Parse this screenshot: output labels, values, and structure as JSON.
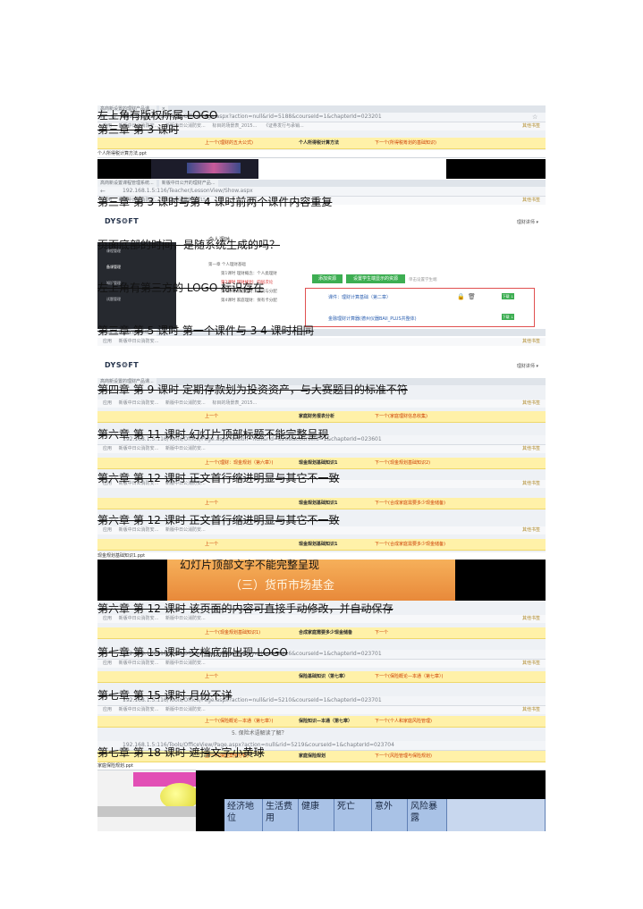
{
  "captions": [
    "左上角有版权所属 LOGO",
    "第三章 第 3 课时",
    "第三章 第 3 课时与第 4 课时前两个课件内容重复",
    "页面底部的时间，是随系统生成的吗？",
    "左上角有第三方的 LOGO 标识存在",
    "第三章 第 5 课时 第一个课件与 3 4 课时相同",
    "第四章 第 9 课时 定期存款划为投资资产，与大赛题目的标准不符",
    "第六章 第 11 课时 幻灯片顶部标题不能完整呈现",
    "第六章 第 12 课时 正文首行缩进明显与其它不一致",
    "第六章 第 12 课时 正文首行缩进明显与其它不一致",
    "幻灯片顶部文字不能完整呈现",
    "第六章 第 12 课时 该页面的内容可直接手动修改，并自动保存",
    "第七章 第 15 课时 文档底部出现 LOGO",
    "第七章 第 15 课时 月份不详",
    "第七章 第 18 课时 遮挡文字小黄球"
  ],
  "urls": [
    "192.168.1.5:116/Tools/Office/Page.aspx?action=null&rid=5188&courseId=1&chapterId=023201",
    "192.168.1.5:116/Teacher/LessonView/Show.aspx",
    "192.168.1.5:116/Tools/Office/Page.aspx?action=null&rid=5208&courseId=1&chapterId=023601",
    "192.168.1.5:116/Tools/Office/Page.aspx?action=null&rid=5216&courseId=1&chapterId=023701",
    "192.168.1.5:116/Tools/Office/Page.aspx?action=null&rid=5210&courseId=1&chapterId=023701",
    "192.168.1.5:116/Tools/OfficeView/Page.aspx?action=null&rid=5219&courseId=1&chapterId=023704"
  ],
  "bookmarks": [
    "应用",
    "新版中日公消防安...",
    "新版中日公消防安...",
    "标目的场景表_2015...",
    "《证券发行与承销..."
  ],
  "bookmark_folder": "其他书签",
  "nav_bars": [
    {
      "prev": "上一个(理财的五大公式)",
      "mid": "个人所得税计算方法",
      "next": "下一个(所得税筹划的基础知识)"
    },
    {
      "prev": "上一个",
      "mid": "家庭财务报表分析",
      "next": "下一个(家庭理财信息收集)"
    },
    {
      "prev": "上一个(理财：现金规划（第六章）)",
      "mid": "现金规划基础知识1",
      "next": "下一个(现金规划基础知识2)"
    },
    {
      "prev": "上一个",
      "mid": "现金规划基础知识1",
      "next": "下一个(合成家庭需要多少现金储备)"
    },
    {
      "prev": "上一个",
      "mid": "现金规划基础知识1",
      "next": "下一个(合成家庭需要多少现金储备)"
    },
    {
      "prev": "上一个(现金规划基础知识1)",
      "mid": "合成家庭需要多少现金储备",
      "next": "下一个"
    },
    {
      "prev": "上一个",
      "mid": "保险基础知识（第七章）",
      "next": "下一个(保险概论—本通（第七章）)"
    },
    {
      "prev": "上一个(保险概论—本通（第七章）)",
      "mid": "保险知识—本通（第七章）",
      "next": "下一个(个人和家庭风险管理)"
    },
    {
      "prev": "上一个(保险案例分析)",
      "mid": "家庭保险规划",
      "next": "下一个(风险管理与保险规划)"
    }
  ],
  "files": [
    "个人所得税计算方法.ppt",
    "现金规划基础知识1.ppt",
    "家庭保险规划.ppt"
  ],
  "lms": {
    "logo": "DYS❂FT",
    "account": "理财讲师 ▾",
    "page_title": "个人课时",
    "sidebar": [
      "课程管理",
      "备课管理",
      "知识管理",
      "试题管理"
    ],
    "lessons": [
      "第一章 个人理财基础",
      "第1课时 理财概念：个人类理财",
      "第2课时 理财规划：四层次论",
      "第3课时 家庭理财：投资与分配",
      "第4课时 家庭理财：保有卡分配"
    ],
    "btn_add": "添加资源",
    "btn_set": "设置学生端显示的资源",
    "hint": "单击设置学生端",
    "items": [
      "课件：理财计算基础（第二章）",
      "金融理财计算器(德州仪器BAII_PLUS共整体)"
    ],
    "download": "下载 ↓"
  },
  "slide_text": "（三）货币市场基金",
  "slide_text2": "5. 保险术语解读了解？",
  "table_cells": [
    "经济地位",
    "生活费用",
    "健康",
    "死亡",
    "意外",
    "风险暴露"
  ],
  "colors": {
    "nav_bar": "#fff1a8",
    "link": "#cc3c00",
    "download": "#3dae52",
    "table": "#a9c2e6"
  }
}
